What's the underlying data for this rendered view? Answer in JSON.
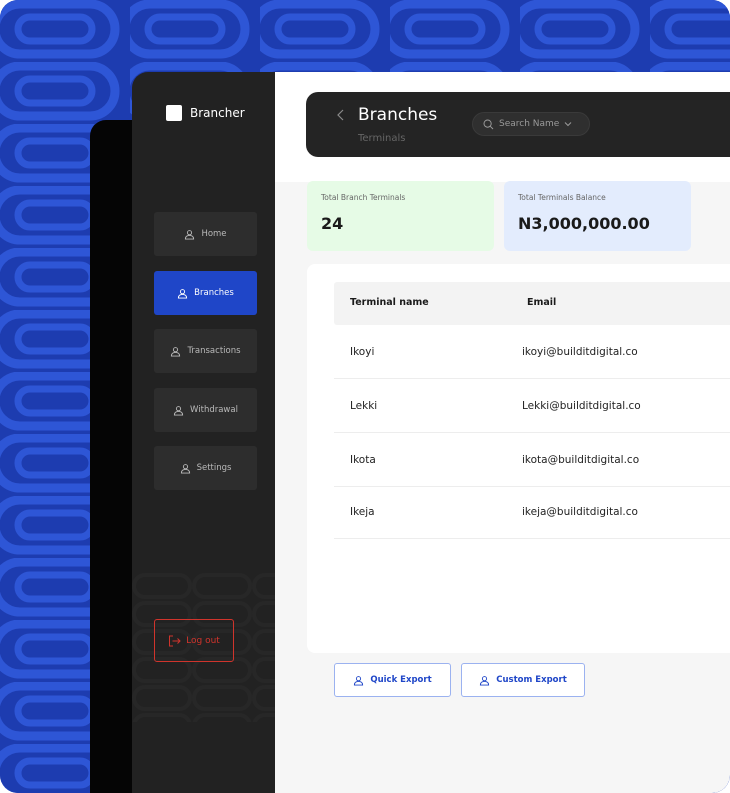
{
  "brand": {
    "name": "Brancher"
  },
  "sidebar": {
    "items": [
      {
        "label": "Home",
        "icon": "user-icon",
        "active": false
      },
      {
        "label": "Branches",
        "icon": "user-icon",
        "active": true
      },
      {
        "label": "Transactions",
        "icon": "user-icon",
        "active": false
      },
      {
        "label": "Withdrawal",
        "icon": "user-icon",
        "active": false
      },
      {
        "label": "Settings",
        "icon": "user-icon",
        "active": false
      }
    ],
    "logout_label": "Log out"
  },
  "header": {
    "title": "Branches",
    "subtitle": "Terminals",
    "search_placeholder": "Search Name"
  },
  "stats": [
    {
      "label": "Total Branch Terminals",
      "value": "24"
    },
    {
      "label": "Total Terminals Balance",
      "value": "N3,000,000.00"
    }
  ],
  "table": {
    "columns": [
      "Terminal name",
      "Email"
    ],
    "rows": [
      {
        "name": "Ikoyi",
        "email": "ikoyi@builditdigital.co"
      },
      {
        "name": "Lekki",
        "email": "Lekki@builditdigital.co"
      },
      {
        "name": "Ikota",
        "email": "ikota@builditdigital.co"
      },
      {
        "name": "Ikeja",
        "email": "ikeja@builditdigital.co"
      }
    ]
  },
  "actions": {
    "quick_export": "Quick Export",
    "custom_export": "Custom Export"
  },
  "colors": {
    "brand_blue": "#1f46c8",
    "sidebar_bg": "#222222",
    "logout_red": "#d0342c",
    "stat_green": "#e6fbe6",
    "stat_blue": "#e3ecfd"
  }
}
